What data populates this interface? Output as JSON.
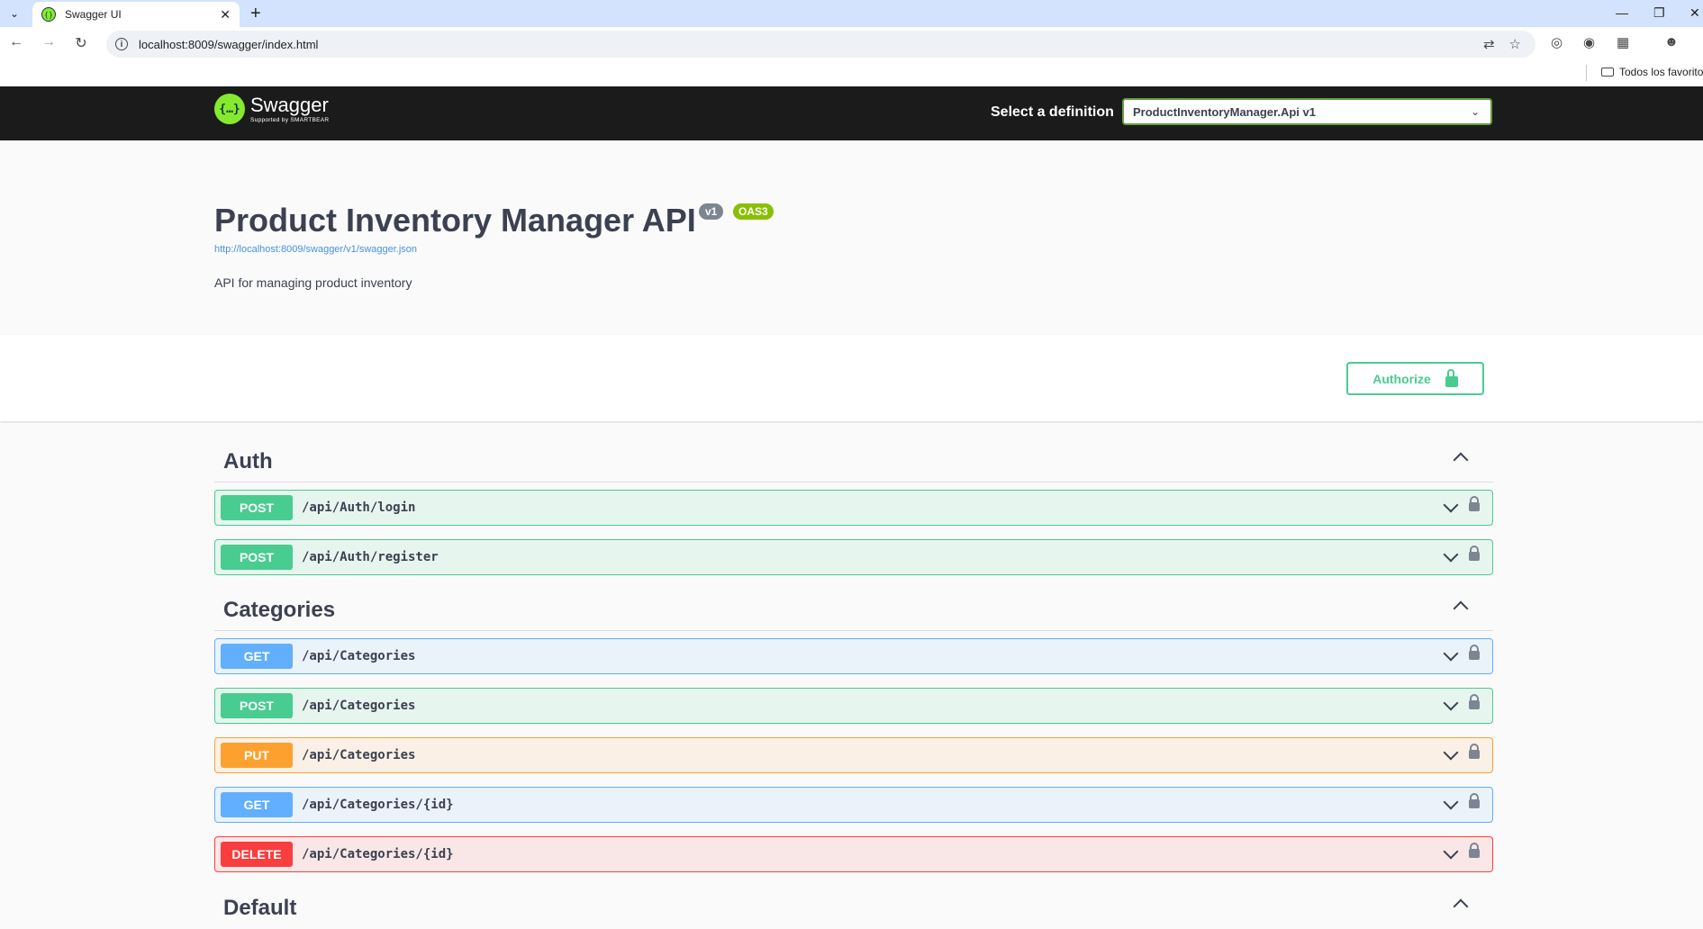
{
  "browser": {
    "tab_title": "Swagger UI",
    "url": "localhost:8009/swagger/index.html",
    "bookmark_folder": "Todos los favoritos"
  },
  "topbar": {
    "logo_text": "Swagger",
    "logo_sub": "Supported by SMARTBEAR",
    "definition_label": "Select a definition",
    "definition_value": "ProductInventoryManager.Api v1"
  },
  "info": {
    "title": "Product Inventory Manager API",
    "version_badge": "v1",
    "oas_badge": "OAS3",
    "spec_url": "http://localhost:8009/swagger/v1/swagger.json",
    "description": "API for managing product inventory"
  },
  "authorize_label": "Authorize",
  "sections": [
    {
      "name": "Auth",
      "operations": [
        {
          "method": "POST",
          "path": "/api/Auth/login"
        },
        {
          "method": "POST",
          "path": "/api/Auth/register"
        }
      ]
    },
    {
      "name": "Categories",
      "operations": [
        {
          "method": "GET",
          "path": "/api/Categories"
        },
        {
          "method": "POST",
          "path": "/api/Categories"
        },
        {
          "method": "PUT",
          "path": "/api/Categories"
        },
        {
          "method": "GET",
          "path": "/api/Categories/{id}"
        },
        {
          "method": "DELETE",
          "path": "/api/Categories/{id}"
        }
      ]
    },
    {
      "name": "Default",
      "operations": []
    }
  ],
  "colors": {
    "post": "#49cc90",
    "get": "#61affe",
    "put": "#fca130",
    "delete": "#f93e3e",
    "topbar": "#1b1b1b",
    "swagger_green": "#85ea2d"
  }
}
